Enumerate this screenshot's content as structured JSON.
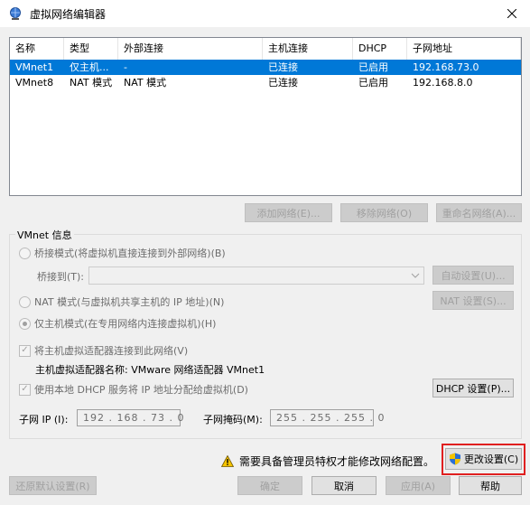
{
  "window": {
    "title": "虚拟网络编辑器"
  },
  "table": {
    "columns": [
      "名称",
      "类型",
      "外部连接",
      "主机连接",
      "DHCP",
      "子网地址"
    ],
    "rows": [
      [
        "VMnet1",
        "仅主机...",
        "-",
        "已连接",
        "已启用",
        "192.168.73.0"
      ],
      [
        "VMnet8",
        "NAT 模式",
        "NAT 模式",
        "已连接",
        "已启用",
        "192.168.8.0"
      ]
    ]
  },
  "network_buttons": {
    "add": "添加网络(E)...",
    "remove": "移除网络(O)",
    "rename": "重命名网络(A)..."
  },
  "vmnet_info": {
    "label": "VMnet 信息",
    "bridged": "桥接模式(将虚拟机直接连接到外部网络)(B)",
    "bridged_to": "桥接到(T):",
    "auto_settings": "自动设置(U)...",
    "nat": "NAT 模式(与虚拟机共享主机的 IP 地址)(N)",
    "nat_settings": "NAT 设置(S)...",
    "host_only": "仅主机模式(在专用网络内连接虚拟机)(H)",
    "connect_adapter": "将主机虚拟适配器连接到此网络(V)",
    "adapter_name": "主机虚拟适配器名称: VMware 网络适配器 VMnet1",
    "use_dhcp": "使用本地 DHCP 服务将 IP 地址分配给虚拟机(D)",
    "dhcp_settings": "DHCP 设置(P)...",
    "subnet_ip_label": "子网 IP (I):",
    "subnet_ip": "192 . 168 . 73 . 0",
    "subnet_mask_label": "子网掩码(M):",
    "subnet_mask": "255 . 255 . 255 . 0"
  },
  "admin": {
    "warning": "需要具备管理员特权才能修改网络配置。",
    "change_settings": "更改设置(C)"
  },
  "footer": {
    "restore": "还原默认设置(R)",
    "ok": "确定",
    "cancel": "取消",
    "apply": "应用(A)",
    "help": "帮助"
  },
  "colors": {
    "selection": "#0078d7",
    "highlight": "#e02020"
  }
}
